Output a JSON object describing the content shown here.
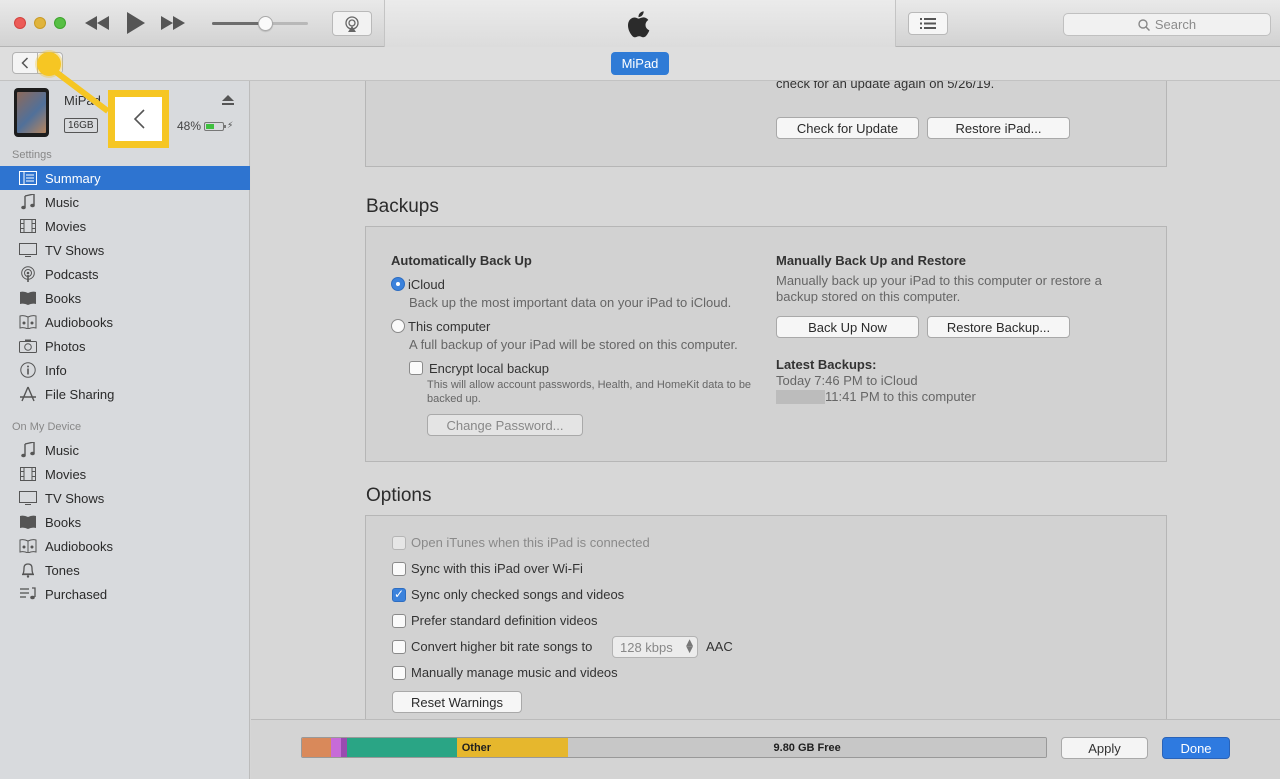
{
  "window": {
    "title_icon": "apple-logo-icon",
    "search_placeholder": "Search"
  },
  "player": {
    "volume_level": 0.55
  },
  "navbar": {
    "device_name": "MiPad"
  },
  "device": {
    "name": "MiPad",
    "capacity": "16GB",
    "battery": "48%",
    "battery_level": 0.48
  },
  "sidebar": {
    "settings_header": "Settings",
    "settings_items": [
      {
        "label": "Summary",
        "icon": "summary-icon",
        "active": true
      },
      {
        "label": "Music",
        "icon": "music-note-icon"
      },
      {
        "label": "Movies",
        "icon": "film-icon"
      },
      {
        "label": "TV Shows",
        "icon": "tv-icon"
      },
      {
        "label": "Podcasts",
        "icon": "podcast-icon"
      },
      {
        "label": "Books",
        "icon": "book-icon"
      },
      {
        "label": "Audiobooks",
        "icon": "audiobook-icon"
      },
      {
        "label": "Photos",
        "icon": "camera-icon"
      },
      {
        "label": "Info",
        "icon": "info-icon"
      },
      {
        "label": "File Sharing",
        "icon": "apps-icon"
      }
    ],
    "device_header": "On My Device",
    "device_items": [
      {
        "label": "Music",
        "icon": "music-note-icon"
      },
      {
        "label": "Movies",
        "icon": "film-icon"
      },
      {
        "label": "TV Shows",
        "icon": "tv-icon"
      },
      {
        "label": "Books",
        "icon": "book-icon"
      },
      {
        "label": "Audiobooks",
        "icon": "audiobook-icon"
      },
      {
        "label": "Tones",
        "icon": "bell-icon"
      },
      {
        "label": "Purchased",
        "icon": "purchased-list-icon"
      }
    ]
  },
  "software": {
    "update_text": "check for an update again on 5/26/19.",
    "check_update_button": "Check for Update",
    "restore_button": "Restore iPad..."
  },
  "backups": {
    "title": "Backups",
    "auto_header": "Automatically Back Up",
    "icloud_label": "iCloud",
    "icloud_desc": "Back up the most important data on your iPad to iCloud.",
    "computer_label": "This computer",
    "computer_desc": "A full backup of your iPad will be stored on this computer.",
    "encrypt_label": "Encrypt local backup",
    "encrypt_desc": "This will allow account passwords, Health, and HomeKit data to be backed up.",
    "change_password_button": "Change Password...",
    "manual_header": "Manually Back Up and Restore",
    "manual_desc": "Manually back up your iPad to this computer or restore a backup stored on this computer.",
    "back_up_now_button": "Back Up Now",
    "restore_backup_button": "Restore Backup...",
    "latest_header": "Latest Backups:",
    "latest_icloud": "Today 7:46 PM to iCloud",
    "latest_computer": "11:41 PM to this computer"
  },
  "options": {
    "title": "Options",
    "items": [
      {
        "label": "Open iTunes when this iPad is connected",
        "checked": false,
        "disabled": true
      },
      {
        "label": "Sync with this iPad over Wi-Fi",
        "checked": false
      },
      {
        "label": "Sync only checked songs and videos",
        "checked": true
      },
      {
        "label": "Prefer standard definition videos",
        "checked": false
      },
      {
        "label": "Convert higher bit rate songs to",
        "checked": false
      },
      {
        "label": "Manually manage music and videos",
        "checked": false
      }
    ],
    "bitrate_value": "128 kbps",
    "bitrate_format": "AAC",
    "reset_warnings_button": "Reset Warnings"
  },
  "storage": {
    "segments": [
      {
        "label": "",
        "color": "#d9895a",
        "fraction": 0.039
      },
      {
        "label": "",
        "color": "#c76bd8",
        "fraction": 0.013
      },
      {
        "label": "",
        "color": "#9a4bb0",
        "fraction": 0.008
      },
      {
        "label": "",
        "color": "#2aa585",
        "fraction": 0.148
      },
      {
        "label": "Other",
        "color": "#e6b72d",
        "fraction": 0.15
      },
      {
        "label": "9.80 GB Free",
        "color": "#c7c7c7",
        "fraction": 0.642
      }
    ],
    "free_label": "9.80 GB Free",
    "other_label": "Other"
  },
  "footer": {
    "apply_button": "Apply",
    "done_button": "Done"
  },
  "colors": {
    "accent": "#2e74d0",
    "highlight": "#f6c623"
  }
}
